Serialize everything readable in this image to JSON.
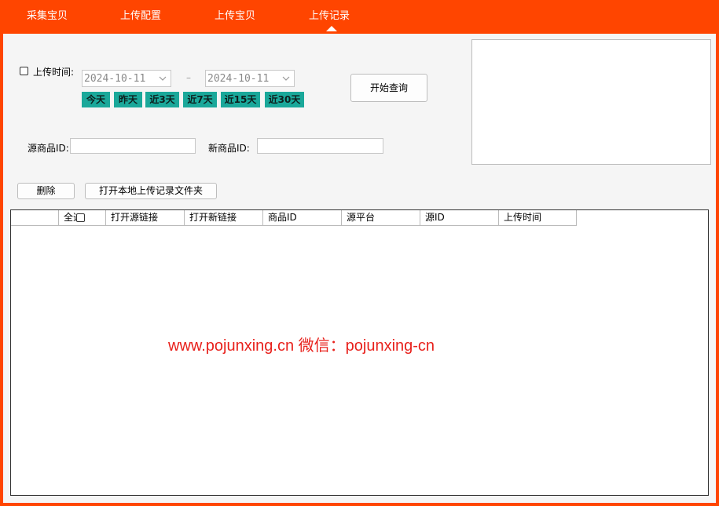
{
  "tabs": [
    {
      "label": "采集宝贝"
    },
    {
      "label": "上传配置"
    },
    {
      "label": "上传宝贝"
    },
    {
      "label": "上传记录"
    }
  ],
  "filters": {
    "upload_time_label": "上传时间:",
    "start_date": "2024-10-11",
    "end_date": "2024-10-11",
    "date_separator": "–",
    "quick_ranges": [
      "今天",
      "昨天",
      "近3天",
      "近7天",
      "近15天",
      "近30天"
    ],
    "quick_color": "#1aa89a",
    "query_button": "开始查询",
    "source_id_label": "源商品ID:",
    "source_id_value": "",
    "new_id_label": "新商品ID:",
    "new_id_value": ""
  },
  "actions": {
    "delete_button": "删除",
    "open_folder_button": "打开本地上传记录文件夹"
  },
  "table": {
    "columns": [
      "",
      "全选",
      "打开源链接",
      "打开新链接",
      "商品ID",
      "源平台",
      "源ID",
      "上传时间"
    ],
    "rows": []
  },
  "watermark": "www.pojunxing.cn 微信：pojunxing-cn",
  "colors": {
    "accent": "#ff4500",
    "watermark": "#e8211c"
  }
}
